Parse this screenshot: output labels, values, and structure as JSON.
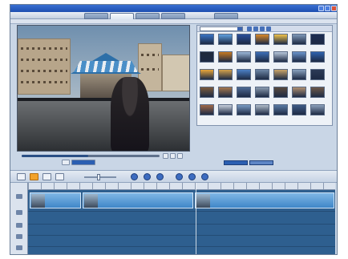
{
  "window": {
    "title": ""
  },
  "menu": {
    "items": [
      "",
      "",
      "",
      ""
    ]
  },
  "tabs": [
    {
      "label": "",
      "active": false
    },
    {
      "label": "",
      "active": true
    },
    {
      "label": "",
      "active": false
    },
    {
      "label": "",
      "active": false
    },
    {
      "label": "",
      "active": false
    }
  ],
  "media_browser": {
    "category_value": "",
    "thumbnail_captions": [
      "",
      "",
      "",
      "",
      "",
      "",
      "",
      "",
      "",
      "",
      "",
      "",
      "",
      "",
      "",
      "",
      "",
      "",
      "",
      "",
      "",
      "",
      "",
      "",
      "",
      "",
      "",
      "",
      "",
      "",
      "",
      "",
      "",
      "",
      ""
    ],
    "thumb_colors": [
      "#3a74c4",
      "#5fa0e0",
      "#2a4f9a",
      "#d9892a",
      "#f0c24a",
      "#7e98b8",
      "#1c2c52",
      "#202a3c",
      "#c87a22",
      "#9cb8d8",
      "#3d6fb8",
      "#b8c8dc",
      "#6a94cc",
      "#2f63b0",
      "#e8a63a",
      "#d4a24c",
      "#4b7fc4",
      "#6e87a6",
      "#caa56a",
      "#8aa2bf",
      "#2c3a56",
      "#7c5a3c",
      "#a6784e",
      "#4d6a94",
      "#8c9cb0",
      "#5a4a3e",
      "#b09070",
      "#6d5848",
      "#a06a4a",
      "#c8d0dc",
      "#7a9cc4",
      "#b0bcc8",
      "#5a7aa4",
      "#3e5a86",
      "#8ea2bc"
    ]
  },
  "playback": {
    "progress": 0.48
  },
  "timeline": {
    "clips": [
      {
        "label": ""
      },
      {
        "label": ""
      },
      {
        "label": ""
      }
    ]
  }
}
